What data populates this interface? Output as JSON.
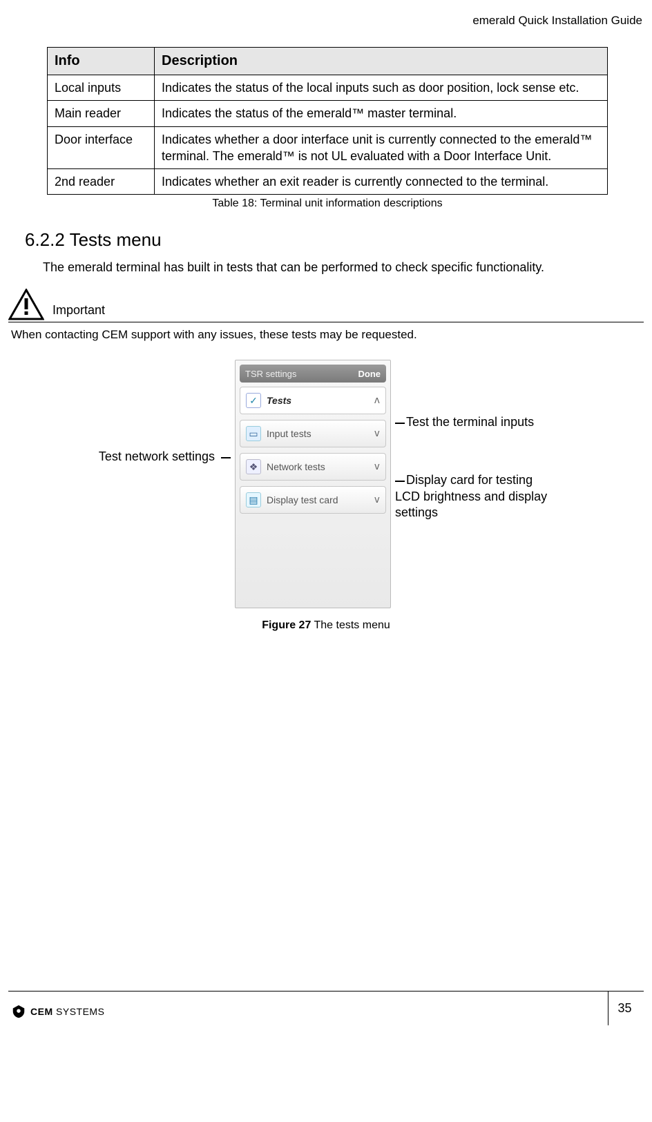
{
  "header": {
    "running_head": "emerald Quick Installation Guide"
  },
  "table": {
    "head": {
      "c1": "Info",
      "c2": "Description"
    },
    "rows": [
      {
        "c1": "Local inputs",
        "c2": "Indicates the status of the local inputs such as door position, lock sense etc."
      },
      {
        "c1": "Main reader",
        "c2": "Indicates the status of the emerald™ master terminal."
      },
      {
        "c1": "Door interface",
        "c2": "Indicates whether a door interface unit is currently connected to the emerald™ terminal. The emerald™ is not UL evaluated with a Door Interface Unit."
      },
      {
        "c1": "2nd reader",
        "c2": "Indicates whether an exit reader is currently connected to the terminal."
      }
    ],
    "caption": "Table 18: Terminal unit information descriptions"
  },
  "section": {
    "number_title": "6.2.2  Tests menu",
    "intro": "The emerald terminal has built in tests that can be performed to check specific functionality."
  },
  "important": {
    "label": "Important",
    "text": "When contacting CEM support with any issues, these tests may be requested."
  },
  "figure": {
    "left_label": "Test network settings",
    "right_label_1": "Test the terminal inputs",
    "right_label_2": "Display card for testing LCD brightness and display settings",
    "device": {
      "head_left": "TSR settings",
      "head_right": "Done",
      "row_tests": "Tests",
      "row_input": "Input tests",
      "row_net": "Network tests",
      "row_card": "Display test card",
      "caret_up": "ʌ",
      "caret_down": "v"
    },
    "caption_bold": "Figure 27",
    "caption_rest": " The tests menu"
  },
  "footer": {
    "brand_bold": "CEM",
    "brand_rest": " SYSTEMS",
    "page_no": "35"
  }
}
